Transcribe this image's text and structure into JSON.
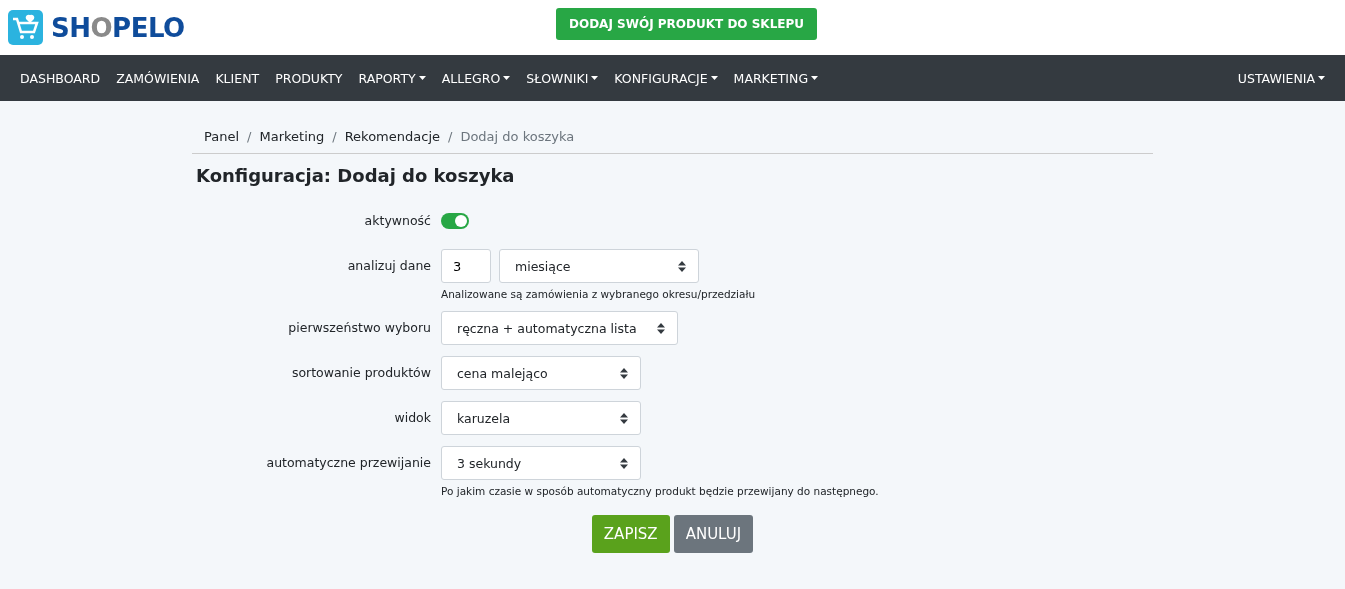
{
  "header": {
    "logo": [
      {
        "text": "SH",
        "accent": false
      },
      {
        "text": "O",
        "accent": true
      },
      {
        "text": "PELO",
        "accent": false
      }
    ],
    "cta": "DODAJ SWÓJ PRODUKT DO SKLEPU"
  },
  "nav": {
    "items": [
      {
        "label": "DASHBOARD",
        "dropdown": false
      },
      {
        "label": "ZAMÓWIENIA",
        "dropdown": false
      },
      {
        "label": "KLIENT",
        "dropdown": false
      },
      {
        "label": "PRODUKTY",
        "dropdown": false
      },
      {
        "label": "RAPORTY",
        "dropdown": true
      },
      {
        "label": "ALLEGRO",
        "dropdown": true
      },
      {
        "label": "SŁOWNIKI",
        "dropdown": true
      },
      {
        "label": "KONFIGURACJE",
        "dropdown": true
      },
      {
        "label": "MARKETING",
        "dropdown": true
      }
    ],
    "right": {
      "label": "USTAWIENIA",
      "dropdown": true
    }
  },
  "breadcrumb": {
    "separator": "/",
    "items": [
      "Panel",
      "Marketing",
      "Rekomendacje",
      "Dodaj do koszyka"
    ]
  },
  "title": "Konfiguracja: Dodaj do koszyka",
  "form": [
    {
      "kind": "switch",
      "label": "aktywność",
      "on": true
    },
    {
      "kind": "number_select",
      "label": "analizuj dane",
      "value": "3",
      "select": "miesiące",
      "help": "Analizowane są zamówienia z wybranego okresu/przedziału"
    },
    {
      "kind": "select",
      "label": "pierwszeństwo wyboru",
      "select": "ręczna + automatyczna lista"
    },
    {
      "kind": "select",
      "label": "sortowanie produktów",
      "select": "cena malejąco"
    },
    {
      "kind": "select",
      "label": "widok",
      "select": "karuzela"
    },
    {
      "kind": "select",
      "label": "automatyczne przewijanie",
      "select": "3 sekundy",
      "help": "Po jakim czasie w sposób automatyczny produkt będzie przewijany do następnego."
    }
  ],
  "buttons": [
    {
      "label": "ZAPISZ",
      "kind": "primary"
    },
    {
      "label": "ANULUJ",
      "kind": "secondary"
    }
  ]
}
